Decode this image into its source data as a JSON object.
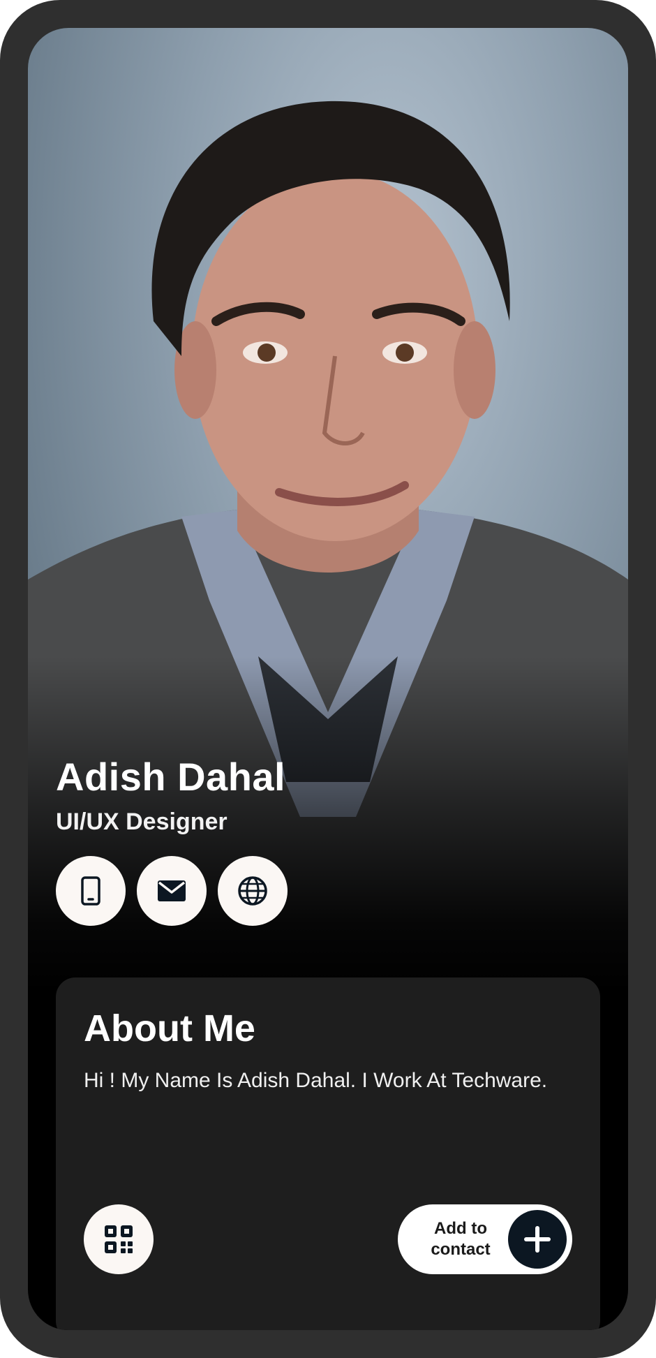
{
  "profile": {
    "name": "Adish Dahal",
    "role": "UI/UX Designer"
  },
  "contact_icons": [
    "phone-icon",
    "mail-icon",
    "globe-icon"
  ],
  "about": {
    "title": "About Me",
    "text": "Hi ! My Name Is Adish Dahal. I Work At Techware."
  },
  "actions": {
    "qr_icon": "qr-code-icon",
    "add_contact_label": "Add to contact",
    "add_icon": "plus-icon"
  },
  "colors": {
    "frame": "#2f2f2f",
    "card": "#1e1e1e",
    "button_bg": "#fbf7f4",
    "plus_circle": "#0c1722"
  }
}
